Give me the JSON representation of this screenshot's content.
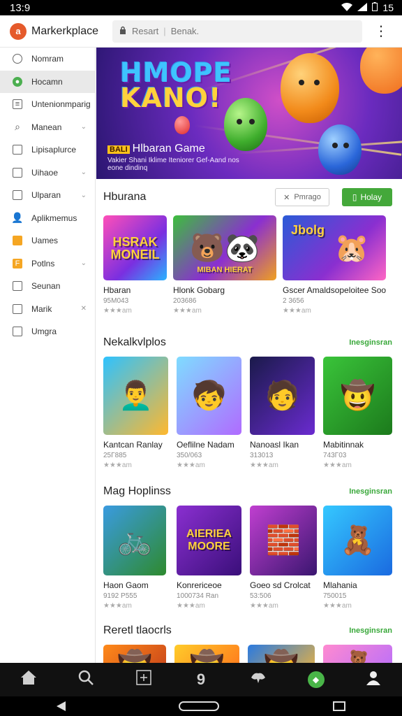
{
  "status": {
    "time": "13:9",
    "battery": "15"
  },
  "header": {
    "logo": "a",
    "title": "Markerkplace",
    "search_text": "Resart",
    "search_filter": "Benak."
  },
  "sidebar": {
    "items": [
      {
        "label": "Nomram",
        "icon": "clock-icon"
      },
      {
        "label": "Hocamn",
        "icon": "leaf-icon"
      },
      {
        "label": "Untenionmparig",
        "icon": "document-icon"
      },
      {
        "label": "Manean",
        "icon": "search-icon"
      },
      {
        "label": "Lipisaplurce",
        "icon": "square-icon"
      },
      {
        "label": "Uihaoe",
        "icon": "square-icon"
      },
      {
        "label": "Ulparan",
        "icon": "square-icon"
      },
      {
        "label": "Aplikmemus",
        "icon": "person-icon"
      },
      {
        "label": "Uames",
        "icon": "bag-icon"
      },
      {
        "label": "Potlns",
        "icon": "tag-icon"
      },
      {
        "label": "Seunan",
        "icon": "lock-icon"
      },
      {
        "label": "Marik",
        "icon": "bookmark-icon"
      },
      {
        "label": "Umgra",
        "icon": "book-icon"
      }
    ]
  },
  "banner": {
    "logo_line1": "HMOPE",
    "logo_line2": "KANO!",
    "tag": "BALI",
    "title": "Hlbaran Game",
    "subtitle": "Vakier Shani Iklime Iteniorer Gef-Aand nos eone dindinq"
  },
  "section1": {
    "title": "Hburana",
    "filter_label": "Pmrago",
    "play_label": "Holay",
    "games": [
      {
        "name": "Hbaran",
        "count": "95M043",
        "rating": "★★★am",
        "art": "HSRAK MONEIL"
      },
      {
        "name": "Hlonk Gobarg",
        "count": "203686",
        "rating": "★★★am",
        "art": "MIBAN HIERAT"
      },
      {
        "name": "Gscer Amaldsopeloitee Soodi",
        "count": "2 3656",
        "rating": "★★★am",
        "art": "Jbolg"
      }
    ]
  },
  "section2": {
    "title": "Nekalkvlplos",
    "link": "Inesginsran",
    "games": [
      {
        "name": "Kantcan Ranlay",
        "count": "25Γ885",
        "rating": "★★★am"
      },
      {
        "name": "Oeflilne Nadam",
        "count": "350/063",
        "rating": "★★★am"
      },
      {
        "name": "Nanoasl Ikan",
        "count": "313013",
        "rating": "★★★am"
      },
      {
        "name": "Mabitinnak",
        "count": "743Γ03",
        "rating": "★★★am"
      }
    ]
  },
  "section3": {
    "title": "Mag Hoplinss",
    "link": "Inesginsran",
    "games": [
      {
        "name": "Haon Gaom",
        "count": "9192 P555",
        "rating": "★★★am",
        "art": ""
      },
      {
        "name": "Konrericeoe",
        "count": "1000734 Ran",
        "rating": "★★★am",
        "art": "AIERIEA MOORE"
      },
      {
        "name": "Goeo sd Crolcat",
        "count": "53:506",
        "rating": "★★★am",
        "art": ""
      },
      {
        "name": "Mlahania",
        "count": "750015",
        "rating": "★★★am",
        "art": ""
      }
    ]
  },
  "section4": {
    "title": "Reretl tlaocrls",
    "link": "Inesginsran"
  },
  "bottom_nav": [
    "home-icon",
    "search-icon",
    "scan-icon",
    "nine-icon",
    "puzzle-icon",
    "games-icon",
    "profile-icon"
  ],
  "bottom_nav_labels": {
    "nine": "9"
  },
  "colors": {
    "accent": "#44a83a",
    "brand": "#e55a2b"
  }
}
